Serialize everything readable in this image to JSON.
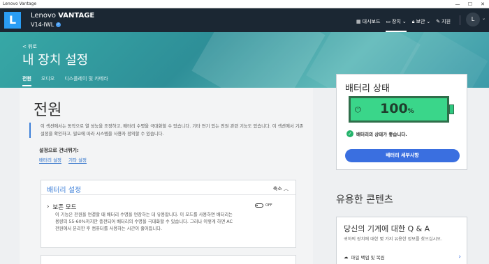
{
  "window": {
    "title": "Lenovo Vantage",
    "controls": [
      "—",
      "☐",
      "✕"
    ]
  },
  "appbar": {
    "logo_letter": "L",
    "brand_prefix": "Lenovo",
    "brand_bold": "VANTAGE",
    "device_name": "V14-IWL",
    "nav": [
      {
        "label": "대시보드",
        "icon": "dashboard-icon"
      },
      {
        "label": "장치",
        "icon": "laptop-icon"
      },
      {
        "label": "보안",
        "icon": "lock-icon"
      },
      {
        "label": "지원",
        "icon": "wrench-icon"
      }
    ],
    "avatar_letter": "L"
  },
  "hero": {
    "back_label": "< 뒤로",
    "title": "내 장치 설정",
    "tabs": [
      "전원",
      "오디오",
      "디스플레이 및 카메라"
    ],
    "active_tab": 0
  },
  "power": {
    "title": "전원",
    "intro_line1": "이 섹션에서는 동작으로 열 성능을 조정하고, 배터리 수명을 극대화할 수 있습니다. 기타 연기 있는 전원 관련 기능도 있습니다. 이 섹션에서 기존",
    "intro_line2": "설정을 확인하고, 필요에 따라 시스템을 사용자 정의할 수 있습니다.",
    "shortcut_title": "설정으로 건너뛰기:",
    "shortcuts": [
      "배터리 설정",
      "기타 설정"
    ]
  },
  "battery_settings": {
    "header": "배터리 설정",
    "collapse_label": "축소",
    "conservation_title": "보존 모드",
    "conservation_desc": "이 기능은 전원을 연결할 때 배터리 수명을 연장하는 데 유용합니다. 이 모드를 사용하면 배터리는 용량의 55-60%까지만 충전되어 배터리의 수명을 극대화할 수 있습니다. 그러나 이렇게 하면 AC 전원에서 분리한 후 컴퓨터를 사용하는 시간이 줄어듭니다.",
    "toggle_label": "OFF",
    "toggle_on": false
  },
  "battery_status": {
    "title": "배터리 상태",
    "percent": "100",
    "percent_unit": "%",
    "level": 1.0,
    "status_text": "배터리의 상태가 좋습니다.",
    "details_button": "배터리 세부사항"
  },
  "useful": {
    "title": "유용한 콘텐츠",
    "qa_title": "당신의 기계에 대한 Q & A",
    "qa_sub": "귀하의 장치에 대한 몇 가지 유용한 정보를 찾으십시오.",
    "link_label": "파일 백업 및 복원"
  },
  "colors": {
    "appbar": "#1b2733",
    "hero": "#37a8a6",
    "accent": "#3a6fe0",
    "battery_fill": "#3ad68a",
    "status_ok": "#24b36b"
  }
}
